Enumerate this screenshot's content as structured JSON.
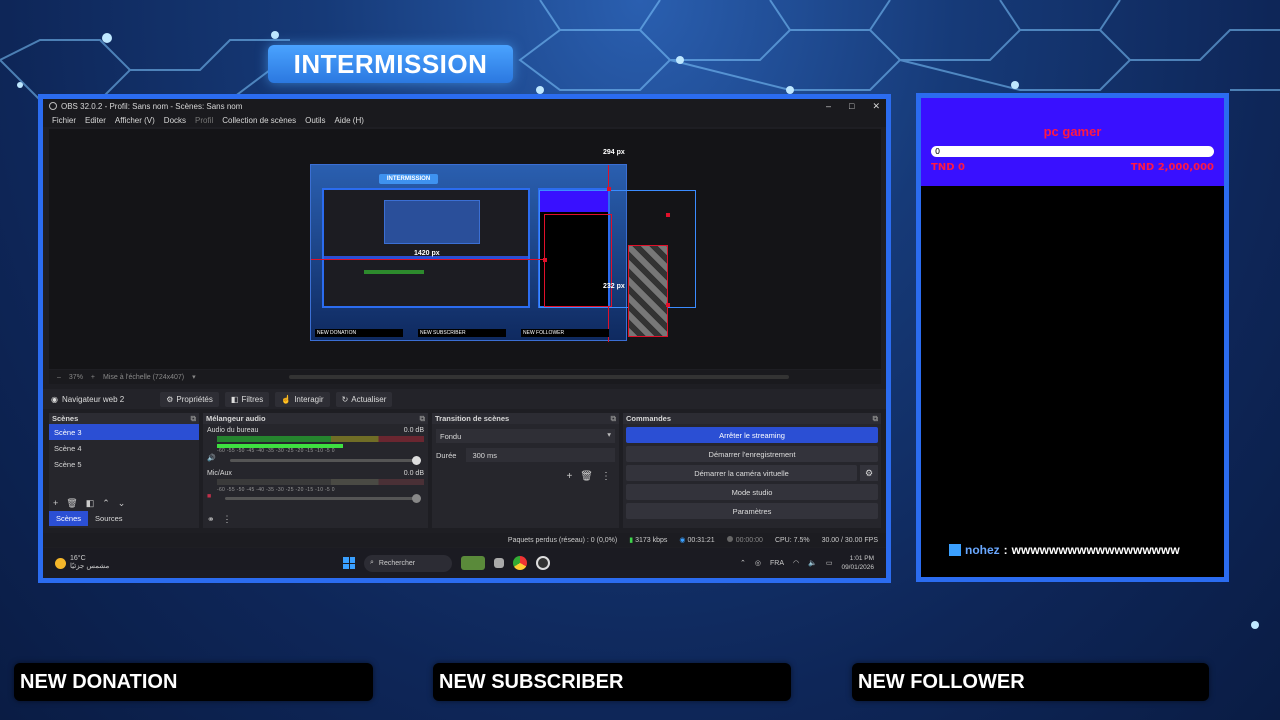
{
  "overlay": {
    "intermission_title": "INTERMISSION",
    "alerts": [
      "NEW DONATION",
      "NEW SUBSCRIBER",
      "NEW FOLLOWER"
    ]
  },
  "obs": {
    "title": "OBS 32.0.2 - Profil: Sans nom - Scènes: Sans nom",
    "menu": [
      "Fichier",
      "Editer",
      "Afficher (V)",
      "Docks",
      "Profil",
      "Collection de scènes",
      "Outils",
      "Aide (H)"
    ],
    "preview": {
      "mini_title": "INTERMISSION",
      "label_1420": "1420 px",
      "label_294": "294 px",
      "label_232": "232 px",
      "mini_alerts": [
        "NEW DONATION",
        "NEW SUBSCRIBER",
        "NEW FOLLOWER"
      ]
    },
    "zoom": {
      "percent": "37%",
      "scale_text": "Mise à l'échelle (724x407)"
    },
    "toolbar": {
      "source_name": "Navigateur web 2",
      "properties": "Propriétés",
      "filters": "Filtres",
      "interact": "Interagir",
      "refresh": "Actualiser"
    },
    "scenes": {
      "header": "Scènes",
      "items": [
        "Scène 3",
        "Scène 4",
        "Scène 5"
      ],
      "tabs": [
        "Scènes",
        "Sources"
      ]
    },
    "mixer": {
      "header": "Mélangeur audio",
      "channels": [
        {
          "name": "Audio du bureau",
          "db": "0.0 dB"
        },
        {
          "name": "Mic/Aux",
          "db": "0.0 dB"
        }
      ],
      "scale": "-60 -55 -50 -45 -40 -35 -30 -25 -20 -15 -10 -5 0"
    },
    "transitions": {
      "header": "Transition de scènes",
      "selected": "Fondu",
      "duration_label": "Durée",
      "duration_value": "300 ms"
    },
    "commands": {
      "header": "Commandes",
      "stop_stream": "Arrêter le streaming",
      "start_rec": "Démarrer l'enregistrement",
      "virtual_cam": "Démarrer la caméra virtuelle",
      "studio": "Mode studio",
      "settings": "Paramètres"
    },
    "status": {
      "dropped": "Paquets perdus (réseau) : 0 (0,0%)",
      "bitrate": "3173 kbps",
      "stream_time": "00:31:21",
      "rec_time": "00:00:00",
      "cpu": "CPU: 7.5%",
      "fps": "30.00 / 30.00 FPS"
    }
  },
  "taskbar": {
    "temp": "16°C",
    "weather": "مشمس جزئيًا",
    "search": "Rechercher",
    "lang": "FRA",
    "time": "1:01 PM",
    "date": "09/01/2026"
  },
  "right_panel": {
    "goal_title": "pc gamer",
    "bar_value": "0",
    "progress": 0,
    "left_text": "TND 0",
    "right_text": "TND 2,000,000",
    "chat_user": "nohez",
    "chat_sep": ":",
    "chat_message": "wwwwwwwwwwwwwwwwww"
  },
  "colors": {
    "frame_blue": "#2b6cf0",
    "goal_purple": "#3910ff",
    "goal_red": "#ff1744",
    "obs_accent": "#2b4fd4"
  }
}
